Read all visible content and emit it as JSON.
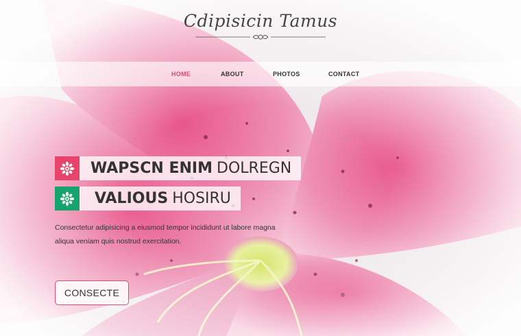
{
  "brand": {
    "title": "Cdipisicin Tamus"
  },
  "nav": {
    "items": [
      {
        "label": "HOME",
        "active": true
      },
      {
        "label": "ABOUT",
        "active": false
      },
      {
        "label": "PHOTOS",
        "active": false
      },
      {
        "label": "CONTACT",
        "active": false
      }
    ]
  },
  "hero": {
    "headline1": {
      "bold": "WAPSCN ENIM",
      "light": "DOLREGN",
      "icon": "flower-icon",
      "badge_color": "#e8436a"
    },
    "headline2": {
      "bold": "VALIOUS",
      "light": "HOSIRU",
      "icon": "flower-icon",
      "badge_color": "#17a36e"
    },
    "description": "Consectetur adipisicing a eiusmod tempor incididunt ut labore magna aliqua veniam quis nostrud exercitation.",
    "cta_label": "CONSECTE"
  },
  "colors": {
    "accent": "#e04a6b",
    "green": "#17a36e"
  }
}
